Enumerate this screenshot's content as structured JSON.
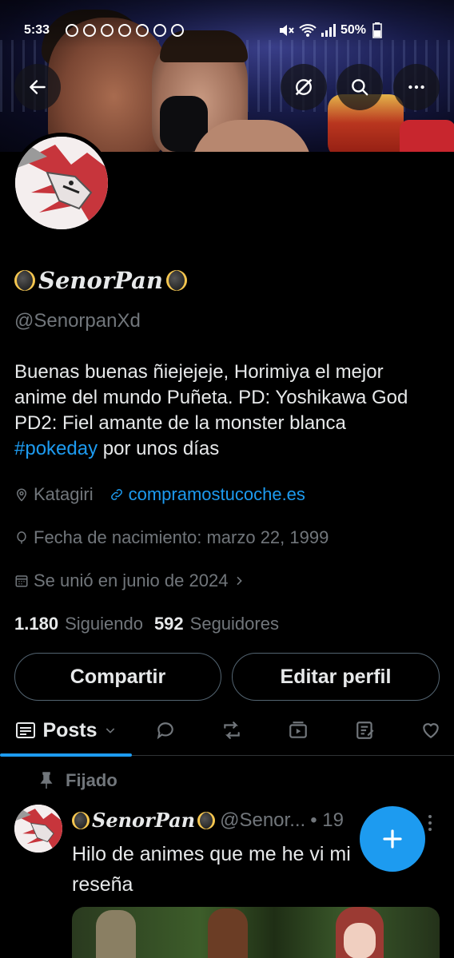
{
  "status_bar": {
    "time": "5:33",
    "battery": "50%"
  },
  "profile": {
    "display_name": "SenorPan",
    "handle": "@SenorpanXd",
    "bio_text": "Buenas buenas ñiejejeje,  Horimiya el mejor anime del mundo Puñeta. PD: Yoshikawa God PD2: Fiel amante de la monster blanca ",
    "bio_hashtag": "#pokeday",
    "bio_tail": " por unos días",
    "location": "Katagiri",
    "website": "compramostucoche.es",
    "birthday": "Fecha de nacimiento: marzo 22, 1999",
    "joined": "Se unió en junio de 2024",
    "following_count": "1.180",
    "following_label": "Siguiendo",
    "followers_count": "592",
    "followers_label": "Seguidores"
  },
  "actions": {
    "share_label": "Compartir",
    "edit_label": "Editar perfil"
  },
  "tabs": {
    "active_label": "Posts",
    "icons": [
      "replies-icon",
      "reposts-icon",
      "media-icon",
      "articles-icon",
      "likes-icon"
    ]
  },
  "pinned_post": {
    "pinned_label": "Fijado",
    "author_name": "SenorPan",
    "author_handle": "@Senor...",
    "time": "• 19",
    "text": "Hilo de animes que me he vi mi reseña"
  },
  "colors": {
    "accent": "#1d9bf0",
    "muted": "#71767b",
    "text": "#e7e9ea",
    "background": "#000000"
  }
}
